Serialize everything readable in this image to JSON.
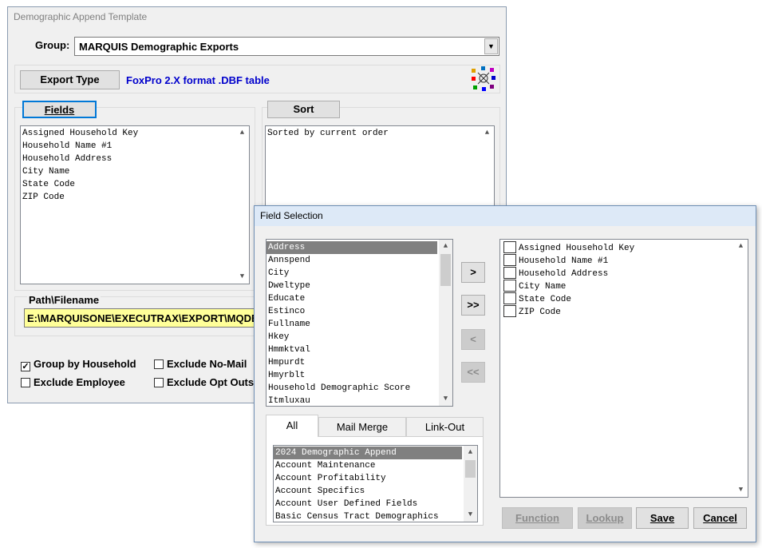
{
  "main_window": {
    "title": "Demographic Append Template",
    "group_label": "Group:",
    "group_value": "MARQUIS Demographic Exports",
    "export_type_button": "Export Type",
    "export_type_value": "FoxPro 2.X format .DBF table",
    "fields_button": "Fields",
    "sort_button": "Sort",
    "fields_list": [
      "Assigned Household Key",
      "Household Name #1",
      "Household Address",
      "City Name",
      "State Code",
      "ZIP Code"
    ],
    "sort_text": "Sorted by current order",
    "path_label": "Path\\Filename",
    "path_value": "E:\\MARQUISONE\\EXECUTRAX\\EXPORT\\MQDE",
    "checkboxes": [
      {
        "label": "Group by Household",
        "checked": true
      },
      {
        "label": "Exclude No-Mail",
        "checked": false
      },
      {
        "label": "Exclude Employee",
        "checked": false
      },
      {
        "label": "Exclude Opt Outs",
        "checked": false
      }
    ]
  },
  "field_selection": {
    "title": "Field Selection",
    "available_fields": [
      "Address",
      "Annspend",
      "City",
      "Dweltype",
      "Educate",
      "Estinco",
      "Fullname",
      "Hkey",
      "Hmmktval",
      "Hmpurdt",
      "Hmyrblt",
      "Household Demographic Score",
      "Itmluxau"
    ],
    "move_buttons": [
      ">",
      ">>",
      "<",
      "<<"
    ],
    "tabs": [
      "All",
      "Mail Merge",
      "Link-Out"
    ],
    "categories": [
      "2024 Demographic Append",
      "Account Maintenance",
      "Account Profitability",
      "Account Specifics",
      "Account User Defined Fields",
      "Basic Census Tract Demographics"
    ],
    "selected_fields": [
      "Assigned Household Key",
      "Household Name #1",
      "Household Address",
      "City Name",
      "State Code",
      "ZIP Code"
    ],
    "buttons": {
      "function": "Function",
      "lookup": "Lookup",
      "save": "Save",
      "cancel": "Cancel"
    }
  },
  "colors": {
    "path_bg": "#ffff99",
    "link_text": "#0000cc",
    "selected_row": "#808080"
  }
}
